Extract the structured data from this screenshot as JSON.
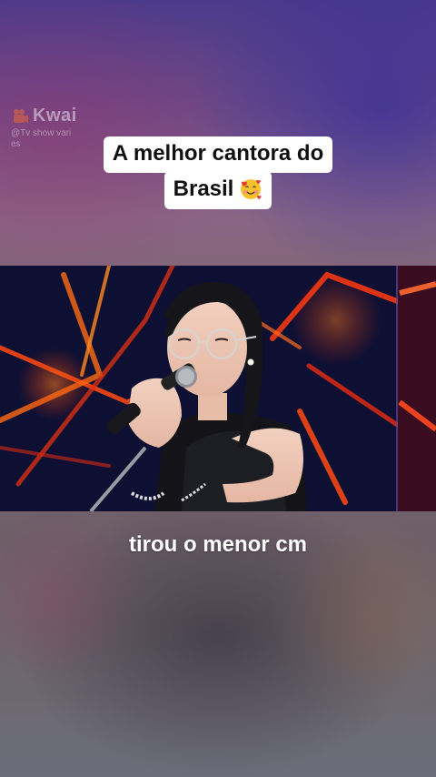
{
  "watermark": {
    "brand": "Kwai",
    "handle": "@Tv show vari",
    "handle_cont": "es",
    "logo_icon": "kwai-camera-logo-icon"
  },
  "caption": {
    "line1": "A melhor cantora do",
    "line2": "Brasil",
    "emoji_icon": "smiling-face-with-hearts-icon"
  },
  "video": {
    "description_icon": "singer-with-microphone-video-frame"
  },
  "subtitle": {
    "text": "tirou o menor cm"
  },
  "colors": {
    "caption_bg": "#ffffff",
    "caption_text": "#111111",
    "subtitle_text": "#ffffff",
    "stage_red": "#e2361a",
    "stage_dark": "#0c0d2a"
  }
}
